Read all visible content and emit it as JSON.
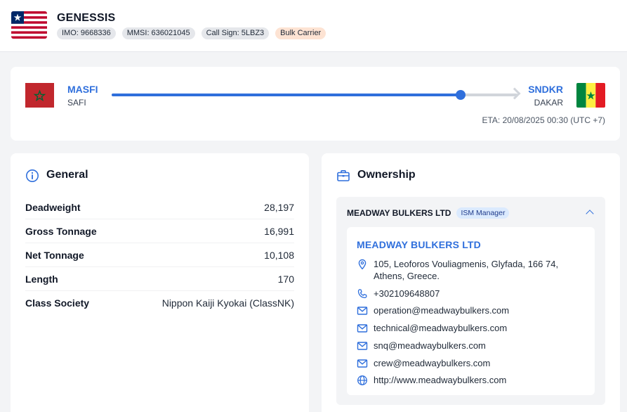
{
  "vessel": {
    "name": "GENESSIS",
    "imo": "IMO: 9668336",
    "mmsi": "MMSI: 636021045",
    "call_sign": "Call Sign: 5LBZ3",
    "type": "Bulk Carrier"
  },
  "route": {
    "origin": {
      "code": "MASFI",
      "name": "SAFI"
    },
    "destination": {
      "code": "SNDKR",
      "name": "DAKAR"
    },
    "progress_percent": 86,
    "eta": "ETA: 20/08/2025 00:30 (UTC +7)"
  },
  "general": {
    "title": "General",
    "rows": [
      {
        "label": "Deadweight",
        "value": "28,197"
      },
      {
        "label": "Gross Tonnage",
        "value": "16,991"
      },
      {
        "label": "Net Tonnage",
        "value": "10,108"
      },
      {
        "label": "Length",
        "value": "170"
      },
      {
        "label": "Class Society",
        "value": "Nippon Kaiji Kyokai (ClassNK)"
      }
    ]
  },
  "ownership": {
    "title": "Ownership",
    "owner_name": "MEADWAY BULKERS LTD",
    "role": "ISM Manager",
    "company": "MEADWAY BULKERS LTD",
    "address_line1": "105, Leoforos Vouliagmenis, Glyfada, 166 74,",
    "address_line2": "Athens, Greece.",
    "phone": "+302109648807",
    "emails": [
      "operation@meadwaybulkers.com",
      "technical@meadwaybulkers.com",
      "snq@meadwaybulkers.com",
      "crew@meadwaybulkers.com"
    ],
    "website": "http://www.meadwaybulkers.com"
  },
  "colors": {
    "accent": "#2f6fdc",
    "vessel_type_badge": "#fde3d3",
    "role_badge": "#dbeafe"
  },
  "icons": {
    "flag": "flag-icon",
    "general": "info-circle-icon",
    "ownership": "briefcase-icon",
    "address": "map-pin-icon",
    "phone": "phone-icon",
    "email": "mail-icon",
    "website": "globe-icon",
    "collapse": "chevron-up-icon"
  }
}
